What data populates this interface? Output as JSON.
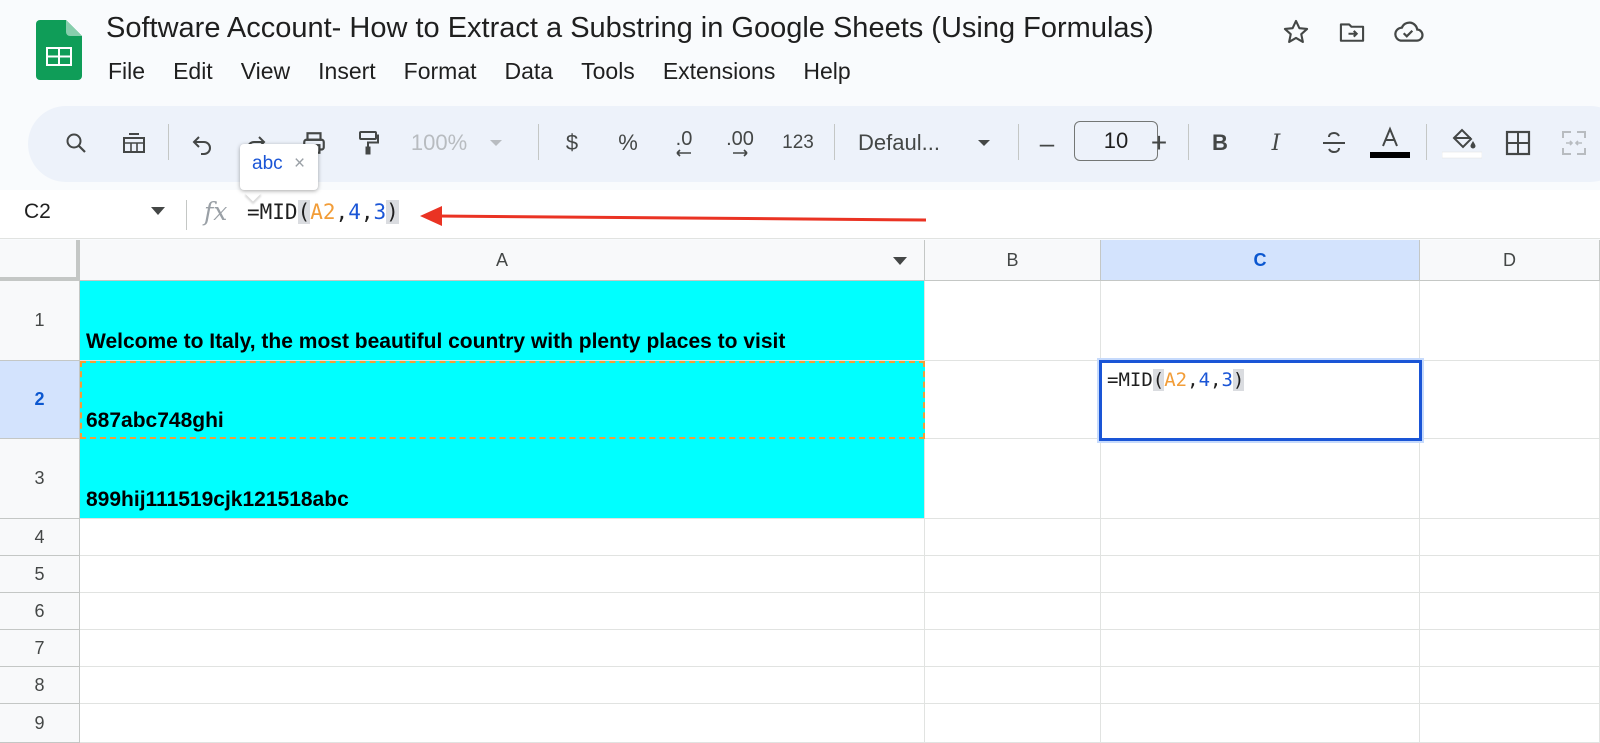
{
  "header": {
    "title": "Software Account- How to Extract a Substring in Google Sheets (Using Formulas)",
    "menu": [
      "File",
      "Edit",
      "View",
      "Insert",
      "Format",
      "Data",
      "Tools",
      "Extensions",
      "Help"
    ],
    "icons": [
      "star-icon",
      "move-to-folder-icon",
      "cloud-saved-icon"
    ]
  },
  "toolbar": {
    "zoom": "100%",
    "currency": "$",
    "percent": "%",
    "decrease_decimal": ".0",
    "increase_decimal": ".00",
    "number_format": "123",
    "font": "Defaul...",
    "font_size": "10",
    "minus": "–",
    "plus": "+",
    "bold": "B",
    "italic": "I"
  },
  "formula_bar": {
    "name_box": "C2",
    "fx": "fx",
    "formula_parts": {
      "prefix": "=MID",
      "open": "(",
      "ref": "A2",
      "comma1": ",",
      "n1": "4",
      "comma2": ",",
      "n2": "3",
      "close": ")"
    }
  },
  "tooltip": {
    "text": "abc",
    "close": "×"
  },
  "columns": [
    "A",
    "B",
    "C",
    "D"
  ],
  "rows": [
    "1",
    "2",
    "3",
    "4",
    "5",
    "6",
    "7",
    "8",
    "9"
  ],
  "cells": {
    "A1": "Welcome to Italy, the most beautiful country with plenty places to visit",
    "A2": "687abc748ghi",
    "A3": "899hij111519cjk121518abc"
  },
  "colors": {
    "cyan": "#00ffff",
    "selection": "#1a55d6",
    "arrow": "#ea3323",
    "ref": "#f29d38",
    "accent": "#d3e3fd"
  }
}
